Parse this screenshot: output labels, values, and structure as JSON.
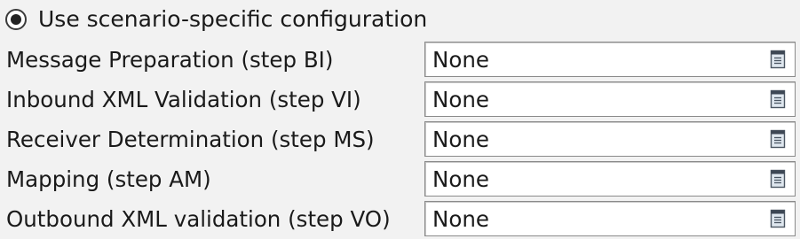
{
  "scenario_option": {
    "label": "Use scenario-specific configuration",
    "selected": true
  },
  "rows": [
    {
      "label": "Message Preparation (step BI)",
      "value": "None",
      "icon": "list-dropdown-icon"
    },
    {
      "label": "Inbound XML Validation (step VI)",
      "value": "None",
      "icon": "list-dropdown-icon"
    },
    {
      "label": "Receiver Determination (step MS)",
      "value": "None",
      "icon": "list-dropdown-icon"
    },
    {
      "label": "Mapping (step AM)",
      "value": "None",
      "icon": "list-dropdown-icon"
    },
    {
      "label": "Outbound XML validation (step VO)",
      "value": "None",
      "icon": "list-dropdown-icon"
    }
  ]
}
